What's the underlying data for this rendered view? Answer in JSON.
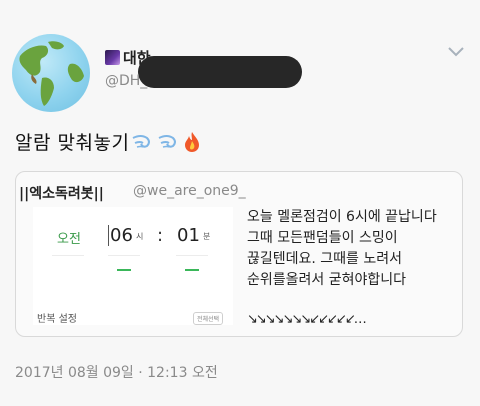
{
  "author": {
    "name_visible": "대한",
    "handle": "@DH_"
  },
  "tweet": {
    "text": "알람 맞춰놓기",
    "emojis": [
      "dashing-away-icon",
      "dashing-away-icon",
      "fire-icon"
    ]
  },
  "quote": {
    "name": "||엑소독려봇||",
    "handle": "@we_are_one9_",
    "lines": [
      "오늘 멜론점검이 6시에 끝납니다",
      "그때 모든팬덤들이 스밍이",
      "끊길텐데요. 그때를 노려서",
      "순위를올려서 굳혀야합니다"
    ],
    "arrows": "↘↘↘↘↘↘↘↙↙↙↙↙…"
  },
  "alarm": {
    "ampm": "오전",
    "hour": "06",
    "hour_unit": "시",
    "colon": ":",
    "minute": "01",
    "minute_unit": "분",
    "repeat_label": "반복 설정",
    "select_all": "전체선택"
  },
  "timestamp": "2017년 08월 09일 · 12:13 오전",
  "colors": {
    "accent_green": "#3ab75a",
    "text_gray": "#8a8a8a",
    "redaction": "#272727"
  }
}
